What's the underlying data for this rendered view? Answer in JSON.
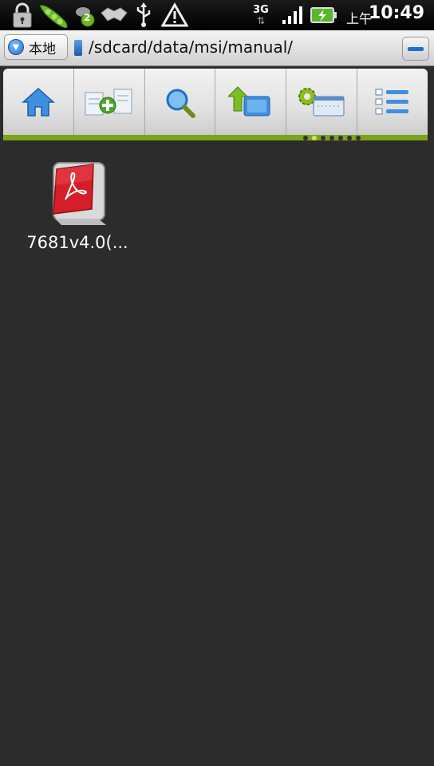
{
  "status_bar": {
    "network": "3G",
    "ampm": "上午",
    "time": "10:49",
    "notification_count": "2",
    "icons": [
      "lock-icon",
      "pea-pod-icon",
      "notification-icon",
      "handshake-icon",
      "usb-icon",
      "warning-icon",
      "network-3g-icon",
      "signal-icon",
      "battery-charging-icon"
    ]
  },
  "path_bar": {
    "location_label": "本地",
    "path": "/sdcard/data/msi/manual/"
  },
  "toolbar": {
    "tools": [
      "home-icon",
      "new-file-icon",
      "search-icon",
      "up-folder-icon",
      "settings-window-icon",
      "list-view-icon"
    ],
    "page_count": 7,
    "active_page": 1
  },
  "files": [
    {
      "name": "7681v4.0(...",
      "type": "pdf-icon"
    }
  ],
  "colors": {
    "accent_green": "#7aa41b",
    "background": "#2c2c2c",
    "folder_blue": "#1f6fc7"
  }
}
